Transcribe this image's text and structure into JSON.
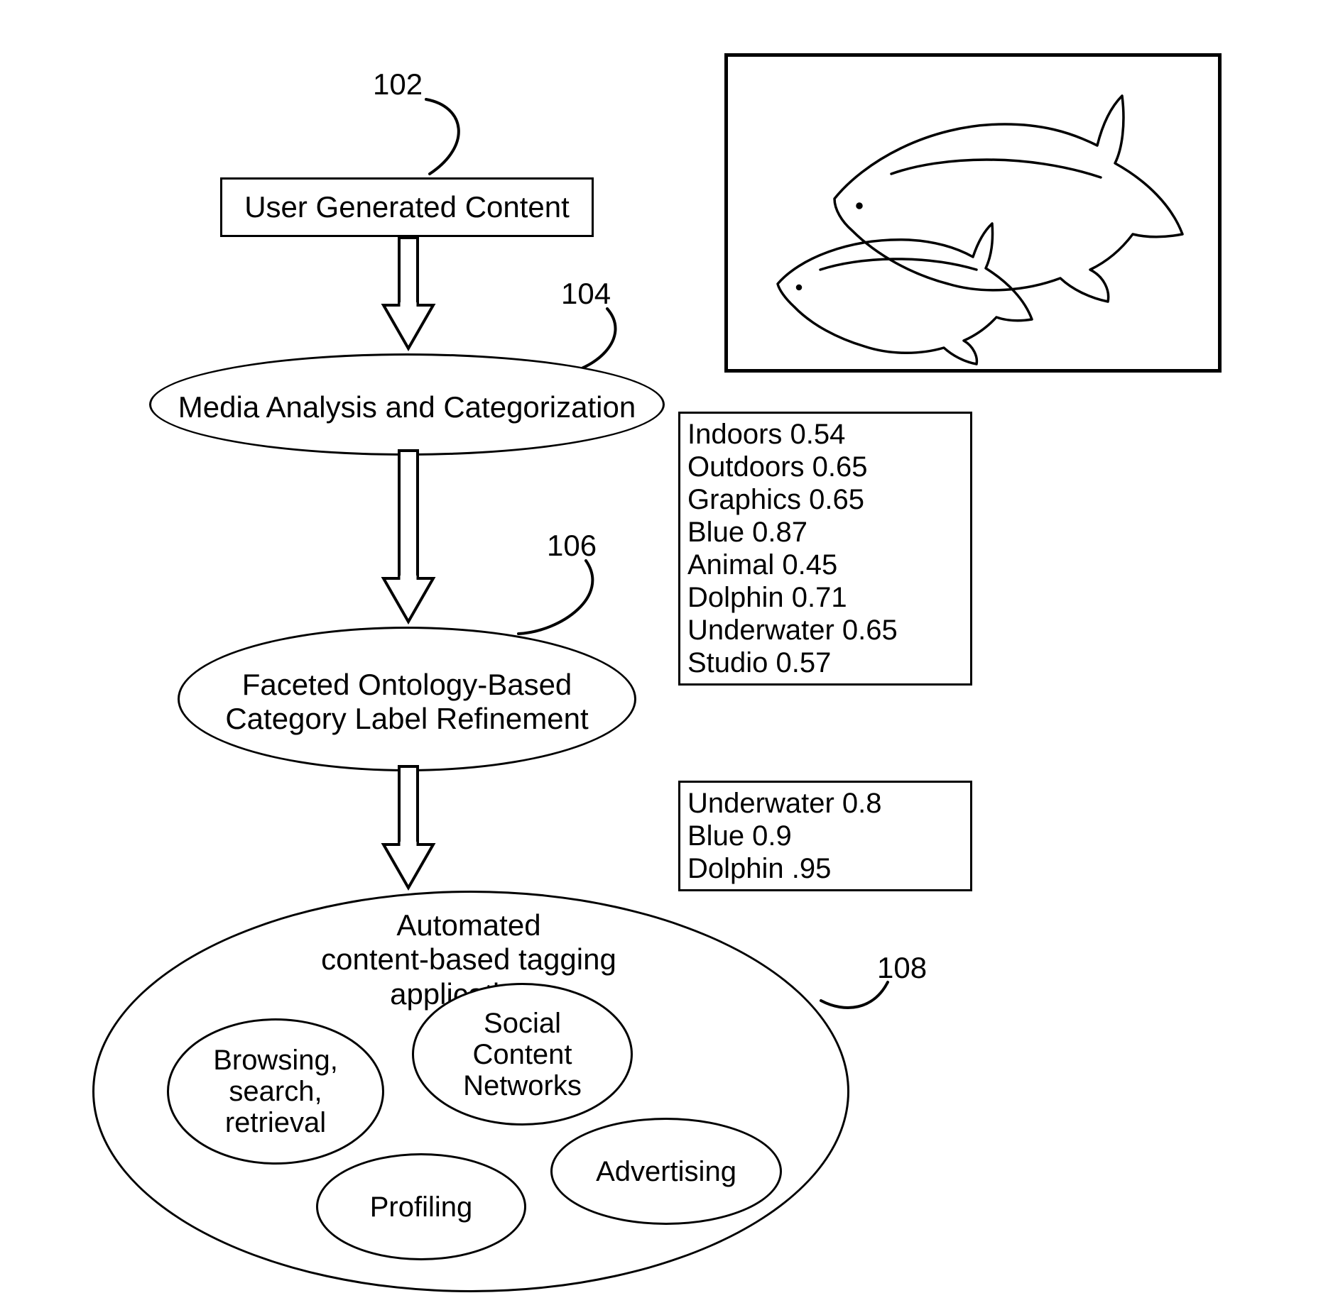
{
  "refs": {
    "r102": "102",
    "r104": "104",
    "r106": "106",
    "r108": "108"
  },
  "nodes": {
    "ugc": "User Generated Content",
    "media": "Media Analysis and Categorization",
    "refine": "Faceted Ontology-Based\nCategory Label Refinement",
    "apps_title": "Automated\ncontent-based tagging applications"
  },
  "sub_nodes": {
    "browsing": "Browsing,\nsearch,\nretrieval",
    "social": "Social\nContent\nNetworks",
    "profiling": "Profiling",
    "advertising": "Advertising"
  },
  "scores_initial": [
    {
      "label": "Indoors",
      "score": "0.54"
    },
    {
      "label": "Outdoors",
      "score": "0.65"
    },
    {
      "label": "Graphics",
      "score": "0.65"
    },
    {
      "label": "Blue",
      "score": "0.87"
    },
    {
      "label": "Animal",
      "score": "0.45"
    },
    {
      "label": "Dolphin",
      "score": "0.71"
    },
    {
      "label": "Underwater",
      "score": "0.65"
    },
    {
      "label": "Studio",
      "score": "0.57"
    }
  ],
  "scores_refined": [
    {
      "label": "Underwater",
      "score": "0.8"
    },
    {
      "label": "Blue",
      "score": "0.9"
    },
    {
      "label": "Dolphin",
      "score": ".95"
    }
  ]
}
